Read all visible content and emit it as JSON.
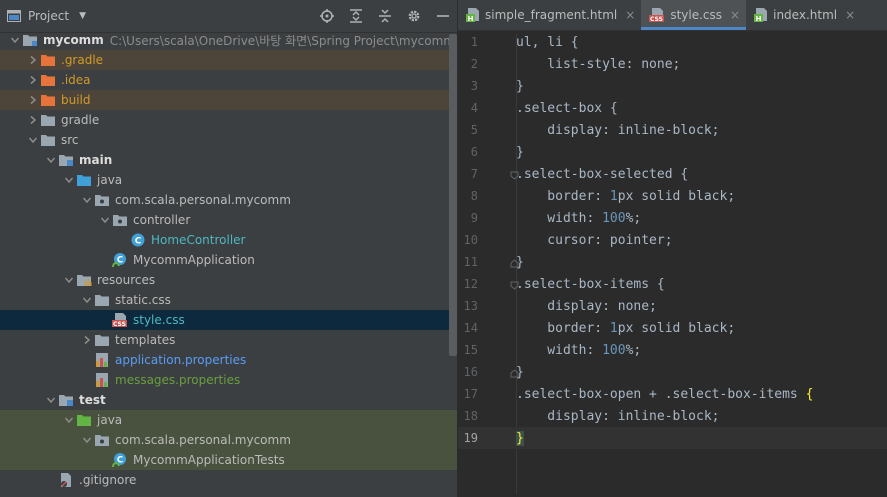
{
  "project_panel": {
    "title": "Project",
    "tools": [
      "locate-icon",
      "expand-all-icon",
      "collapse-all-icon",
      "gear-icon",
      "hide-icon"
    ]
  },
  "tree": [
    {
      "label": "mycomm",
      "path": "C:\\Users\\scala\\OneDrive\\바탕 화면\\Spring Project\\mycomm",
      "depth": 0,
      "arrow": "down",
      "icon": "module",
      "style": "bold"
    },
    {
      "label": ".gradle",
      "depth": 1,
      "arrow": "right",
      "icon": "folder-orange",
      "style": "orange",
      "bg": "excluded"
    },
    {
      "label": ".idea",
      "depth": 1,
      "arrow": "right",
      "icon": "folder-orange",
      "style": "orange"
    },
    {
      "label": "build",
      "depth": 1,
      "arrow": "right",
      "icon": "folder-orange",
      "style": "orange",
      "bg": "excluded"
    },
    {
      "label": "gradle",
      "depth": 1,
      "arrow": "right",
      "icon": "folder",
      "style": ""
    },
    {
      "label": "src",
      "depth": 1,
      "arrow": "down",
      "icon": "folder",
      "style": ""
    },
    {
      "label": "main",
      "depth": 2,
      "arrow": "down",
      "icon": "folder-module",
      "style": "bold"
    },
    {
      "label": "java",
      "depth": 3,
      "arrow": "down",
      "icon": "folder-blue",
      "style": ""
    },
    {
      "label": "com.scala.personal.mycomm",
      "depth": 4,
      "arrow": "down",
      "icon": "package",
      "style": ""
    },
    {
      "label": "controller",
      "depth": 5,
      "arrow": "down",
      "icon": "package",
      "style": ""
    },
    {
      "label": "HomeController",
      "depth": 6,
      "arrow": "",
      "icon": "class",
      "style": "teal"
    },
    {
      "label": "MycommApplication",
      "depth": 5,
      "arrow": "",
      "icon": "spring-class",
      "style": ""
    },
    {
      "label": "resources",
      "depth": 3,
      "arrow": "down",
      "icon": "folder-resources",
      "style": ""
    },
    {
      "label": "static.css",
      "depth": 4,
      "arrow": "down",
      "icon": "folder",
      "style": ""
    },
    {
      "label": "style.css",
      "depth": 5,
      "arrow": "",
      "icon": "css",
      "style": "teal",
      "bg": "selected"
    },
    {
      "label": "templates",
      "depth": 4,
      "arrow": "right",
      "icon": "folder",
      "style": ""
    },
    {
      "label": "application.properties",
      "depth": 4,
      "arrow": "",
      "icon": "properties",
      "style": "blue"
    },
    {
      "label": "messages.properties",
      "depth": 4,
      "arrow": "",
      "icon": "properties",
      "style": "green"
    },
    {
      "label": "test",
      "depth": 2,
      "arrow": "down",
      "icon": "folder-module",
      "style": "bold"
    },
    {
      "label": "java",
      "depth": 3,
      "arrow": "down",
      "icon": "folder-green",
      "style": "",
      "bg": "test-area"
    },
    {
      "label": "com.scala.personal.mycomm",
      "depth": 4,
      "arrow": "down",
      "icon": "package",
      "style": "",
      "bg": "test-area"
    },
    {
      "label": "MycommApplicationTests",
      "depth": 5,
      "arrow": "",
      "icon": "spring-class",
      "style": "",
      "bg": "test-area"
    },
    {
      "label": ".gitignore",
      "depth": 2,
      "arrow": "",
      "icon": "gitignore",
      "style": ""
    }
  ],
  "tabs": [
    {
      "label": "simple_fragment.html",
      "icon": "html",
      "active": false
    },
    {
      "label": "style.css",
      "icon": "css",
      "active": true
    },
    {
      "label": "index.html",
      "icon": "html",
      "active": false
    }
  ],
  "code_lines": [
    "ul, li {",
    "    list-style: none;",
    "}",
    ".select-box {",
    "    display: inline-block;",
    "}",
    ".select-box-selected {",
    "    border: 1px solid black;",
    "    width: 100%;",
    "    cursor: pointer;",
    "}",
    ".select-box-items {",
    "    display: none;",
    "    border: 1px solid black;",
    "    width: 100%;",
    "}",
    ".select-box-open + .select-box-items {",
    "    display: inline-block;",
    "}"
  ],
  "current_line": 19,
  "colors": {
    "accent": "#4a88c7",
    "panel": "#3c3f41",
    "editor": "#2b2b2b",
    "selected": "#0d293e"
  }
}
